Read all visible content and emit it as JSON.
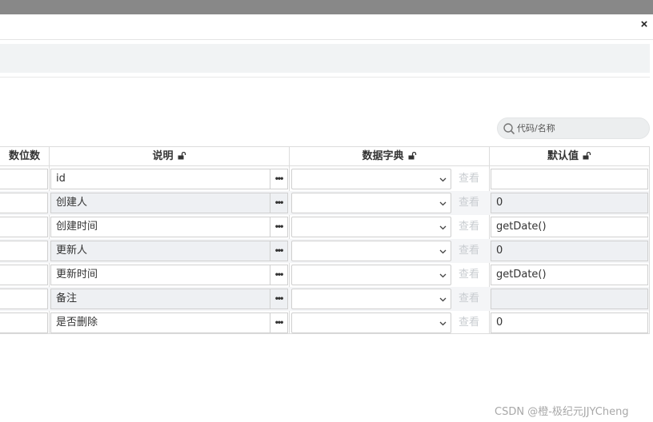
{
  "dialog": {
    "close_glyph": "×"
  },
  "search": {
    "placeholder": "代码/名称"
  },
  "table": {
    "columns": {
      "decimal": "数位数",
      "description": "说明",
      "dictionary": "数据字典",
      "default": "默认值"
    },
    "more_glyph": "•••",
    "view_label": "查看",
    "rows": [
      {
        "description": "id",
        "default": ""
      },
      {
        "description": "创建人",
        "default": "0"
      },
      {
        "description": "创建时间",
        "default": "getDate()"
      },
      {
        "description": "更新人",
        "default": "0"
      },
      {
        "description": "更新时间",
        "default": "getDate()"
      },
      {
        "description": "备注",
        "default": ""
      },
      {
        "description": "是否删除",
        "default": "0"
      }
    ]
  },
  "watermark": "CSDN @橙-极纪元JJYCheng",
  "colors": {
    "topbar": "#888888",
    "band": "#f1f3f4",
    "alt_row": "#f4f5f7",
    "disabled_text": "#c8ccd0"
  }
}
